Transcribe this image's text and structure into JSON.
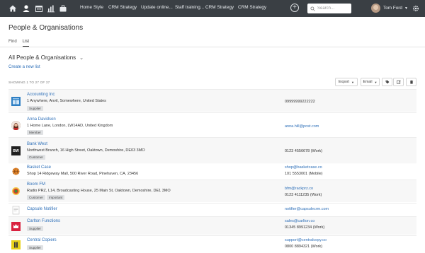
{
  "topbar": {
    "nav": [
      "Home Style",
      "CRM Strategy",
      "Update online...",
      "Staff training...",
      "CRM Strategy",
      "CRM Strategy"
    ],
    "search_placeholder": "Search...",
    "user_name": "Tom Ford",
    "bg_color": "#3a3f44",
    "left_icons": [
      "home-icon",
      "user-icon",
      "calendar-icon",
      "chart-icon",
      "briefcase-icon"
    ],
    "right_icons": [
      "plus-circle-icon",
      "search-icon",
      "gear-icon"
    ]
  },
  "page": {
    "title": "People & Organisations",
    "tabs": [
      "Find",
      "List"
    ],
    "active_tab": "List",
    "view_title": "All People & Organisations",
    "create_link": "Create a new list",
    "showing": "SHOWING 1 TO 27 OF 37",
    "export_label": "Export",
    "email_label": "Email",
    "link_color": "#2d6fb8"
  },
  "rows": [
    {
      "name": "Accounting Inc",
      "address": "1 Anywhere, Anvil, Somewhere, United States",
      "tags": [
        "Supplier"
      ],
      "contact1": "09999999222222",
      "contact2": "",
      "logo": "accounting-inc-logo"
    },
    {
      "name": "Anna Davidson",
      "address": "1 Home Lane, London, LW14AD, United Kingdom",
      "tags": [
        "Member"
      ],
      "contact1": "anna.hill@post.com",
      "contact2": "",
      "logo": "anna-davidson-avatar"
    },
    {
      "name": "Bank West",
      "address": "Northwest Branch, 16 High Street, Oaktown, Demoshire, DE03 3MO",
      "tags": [
        "Customer"
      ],
      "contact1": "0123 4556678 (Work)",
      "contact2": "",
      "logo": "bank-west-logo",
      "logo_text": "BW"
    },
    {
      "name": "Basket Case",
      "address": "Shop 14 Ridgeway Mall, 500 River Road, Pinehaven, CA, 23456",
      "tags": [],
      "contact1": "shop@basketcase.co",
      "contact2": "101 5553001 (Mobile)",
      "logo": "basket-case-logo"
    },
    {
      "name": "Boom FM",
      "address": "Radio PRZ, L14, Broadcasting House, 25 Main St, Oaktown, Demoshire, DE1 3MO",
      "tags": [
        "Customer",
        "Important"
      ],
      "contact1": "bfm@rackprz.co",
      "contact2": "0123 4111235 (Work)",
      "logo": "boom-fm-logo"
    },
    {
      "name": "Capsule Notifier",
      "address": "",
      "tags": [],
      "contact1": "notifier@capsulecrm.com",
      "contact2": "",
      "logo": "capsule-notifier-logo"
    },
    {
      "name": "Carlton Functions",
      "address": "",
      "tags": [
        "Supplier"
      ],
      "contact1": "sales@carlton.co",
      "contact2": "01345 8991234 (Work)",
      "logo": "carlton-functions-logo"
    },
    {
      "name": "Central Copiers",
      "address": "",
      "tags": [
        "Supplier"
      ],
      "contact1": "support@centralcopy.co",
      "contact2": "0800 8894321 (Work)",
      "logo": "central-copiers-logo"
    }
  ]
}
